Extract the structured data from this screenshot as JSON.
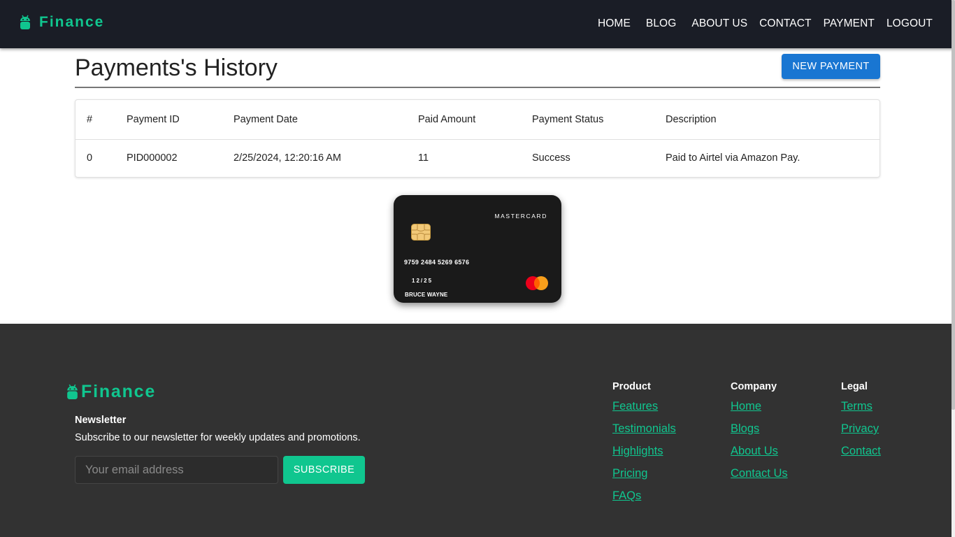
{
  "nav": {
    "brand": "Finance",
    "links": [
      "HOME",
      "BLOG",
      "ABOUT US",
      "CONTACT",
      "PAYMENT",
      "LOGOUT"
    ]
  },
  "main": {
    "title": "Payments's History",
    "new_payment_label": "NEW PAYMENT",
    "table": {
      "headers": [
        "#",
        "Payment ID",
        "Payment Date",
        "Paid Amount",
        "Payment Status",
        "Description"
      ],
      "rows": [
        [
          "0",
          "PID000002",
          "2/25/2024, 12:20:16 AM",
          "11",
          "Success",
          "Paid to Airtel via Amazon Pay."
        ]
      ]
    }
  },
  "card": {
    "brand": "MASTERCARD",
    "number": "9759 2484 5269 6576",
    "expiry": "12/25",
    "holder": "BRUCE WAYNE"
  },
  "footer": {
    "brand": "Finance",
    "newsletter_title": "Newsletter",
    "newsletter_text": "Subscribe to our newsletter for weekly updates and promotions.",
    "email_placeholder": "Your email address",
    "subscribe_label": "SUBSCRIBE",
    "columns": [
      {
        "title": "Product",
        "links": [
          "Features",
          "Testimonials",
          "Highlights",
          "Pricing",
          "FAQs"
        ]
      },
      {
        "title": "Company",
        "links": [
          "Home",
          "Blogs",
          "About Us",
          "Contact Us"
        ]
      },
      {
        "title": "Legal",
        "links": [
          "Terms",
          "Privacy",
          "Contact"
        ]
      }
    ]
  },
  "colors": {
    "accent": "#10c68f",
    "primary_button": "#1976d2",
    "navbar": "#1a1d26",
    "footer": "#323232"
  }
}
